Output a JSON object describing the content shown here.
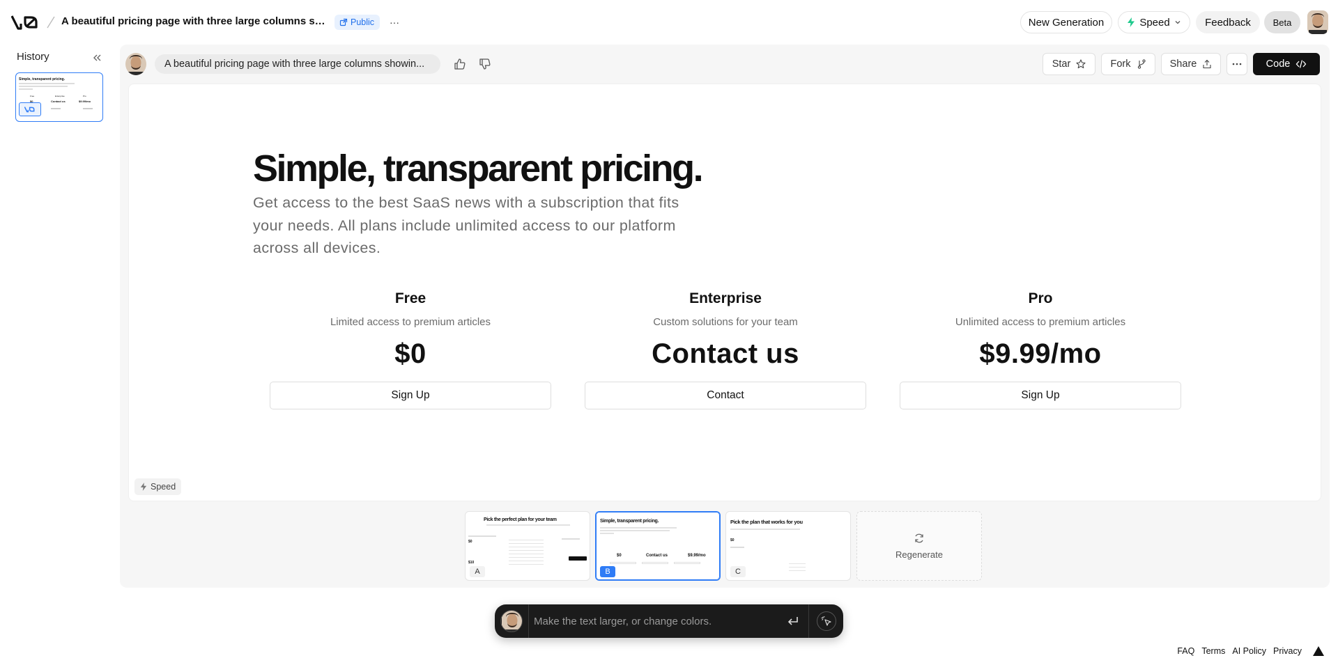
{
  "topbar": {
    "title": "A beautiful pricing page with three large columns showin...",
    "visibility_badge": "Public",
    "more_label": "···",
    "new_generation_label": "New Generation",
    "model_select_label": "Speed",
    "feedback_label": "Feedback",
    "beta_label": "Beta"
  },
  "history": {
    "title": "History",
    "thumb": {
      "title": "Simple, transparent pricing.",
      "plans": [
        "Free",
        "Enterprise",
        "Pro"
      ],
      "prices": [
        "$0",
        "Contact us",
        "$9.99/mo"
      ]
    }
  },
  "chat": {
    "prompt": "A beautiful pricing page with three large columns showin...",
    "star_label": "Star",
    "fork_label": "Fork",
    "share_label": "Share",
    "code_label": "Code"
  },
  "preview": {
    "title": "Simple, transparent pricing.",
    "subtitle": "Get access to the best SaaS news with a subscription that fits your needs. All plans include unlimited access to our platform across all devices.",
    "plans": [
      {
        "name": "Free",
        "description": "Limited access to premium articles",
        "price": "$0",
        "button": "Sign Up"
      },
      {
        "name": "Enterprise",
        "description": "Custom solutions for your team",
        "price": "Contact us",
        "button": "Contact"
      },
      {
        "name": "Pro",
        "description": "Unlimited access to premium articles",
        "price": "$9.99/mo",
        "button": "Sign Up"
      }
    ],
    "model_tag": "Speed"
  },
  "variants": [
    {
      "letter": "A",
      "title": "Pick the perfect plan for your team",
      "selected": false,
      "prices": [
        "$0",
        "$10"
      ]
    },
    {
      "letter": "B",
      "title": "Simple, transparent pricing.",
      "selected": true,
      "prices": [
        "$0",
        "Contact us",
        "$9.99/mo"
      ]
    },
    {
      "letter": "C",
      "title": "Pick the plan that works for you",
      "selected": false,
      "prices": [
        "$0"
      ]
    }
  ],
  "regenerate_label": "Regenerate",
  "composer": {
    "placeholder": "Make the text larger, or change colors."
  },
  "footer": {
    "links": [
      "FAQ",
      "Terms",
      "AI Policy",
      "Privacy"
    ]
  },
  "colors": {
    "accent_blue": "#2f7cf6",
    "badge_bg": "#e8f1fe",
    "code_button": "#111111",
    "speed_icon": "#1ec98c"
  }
}
